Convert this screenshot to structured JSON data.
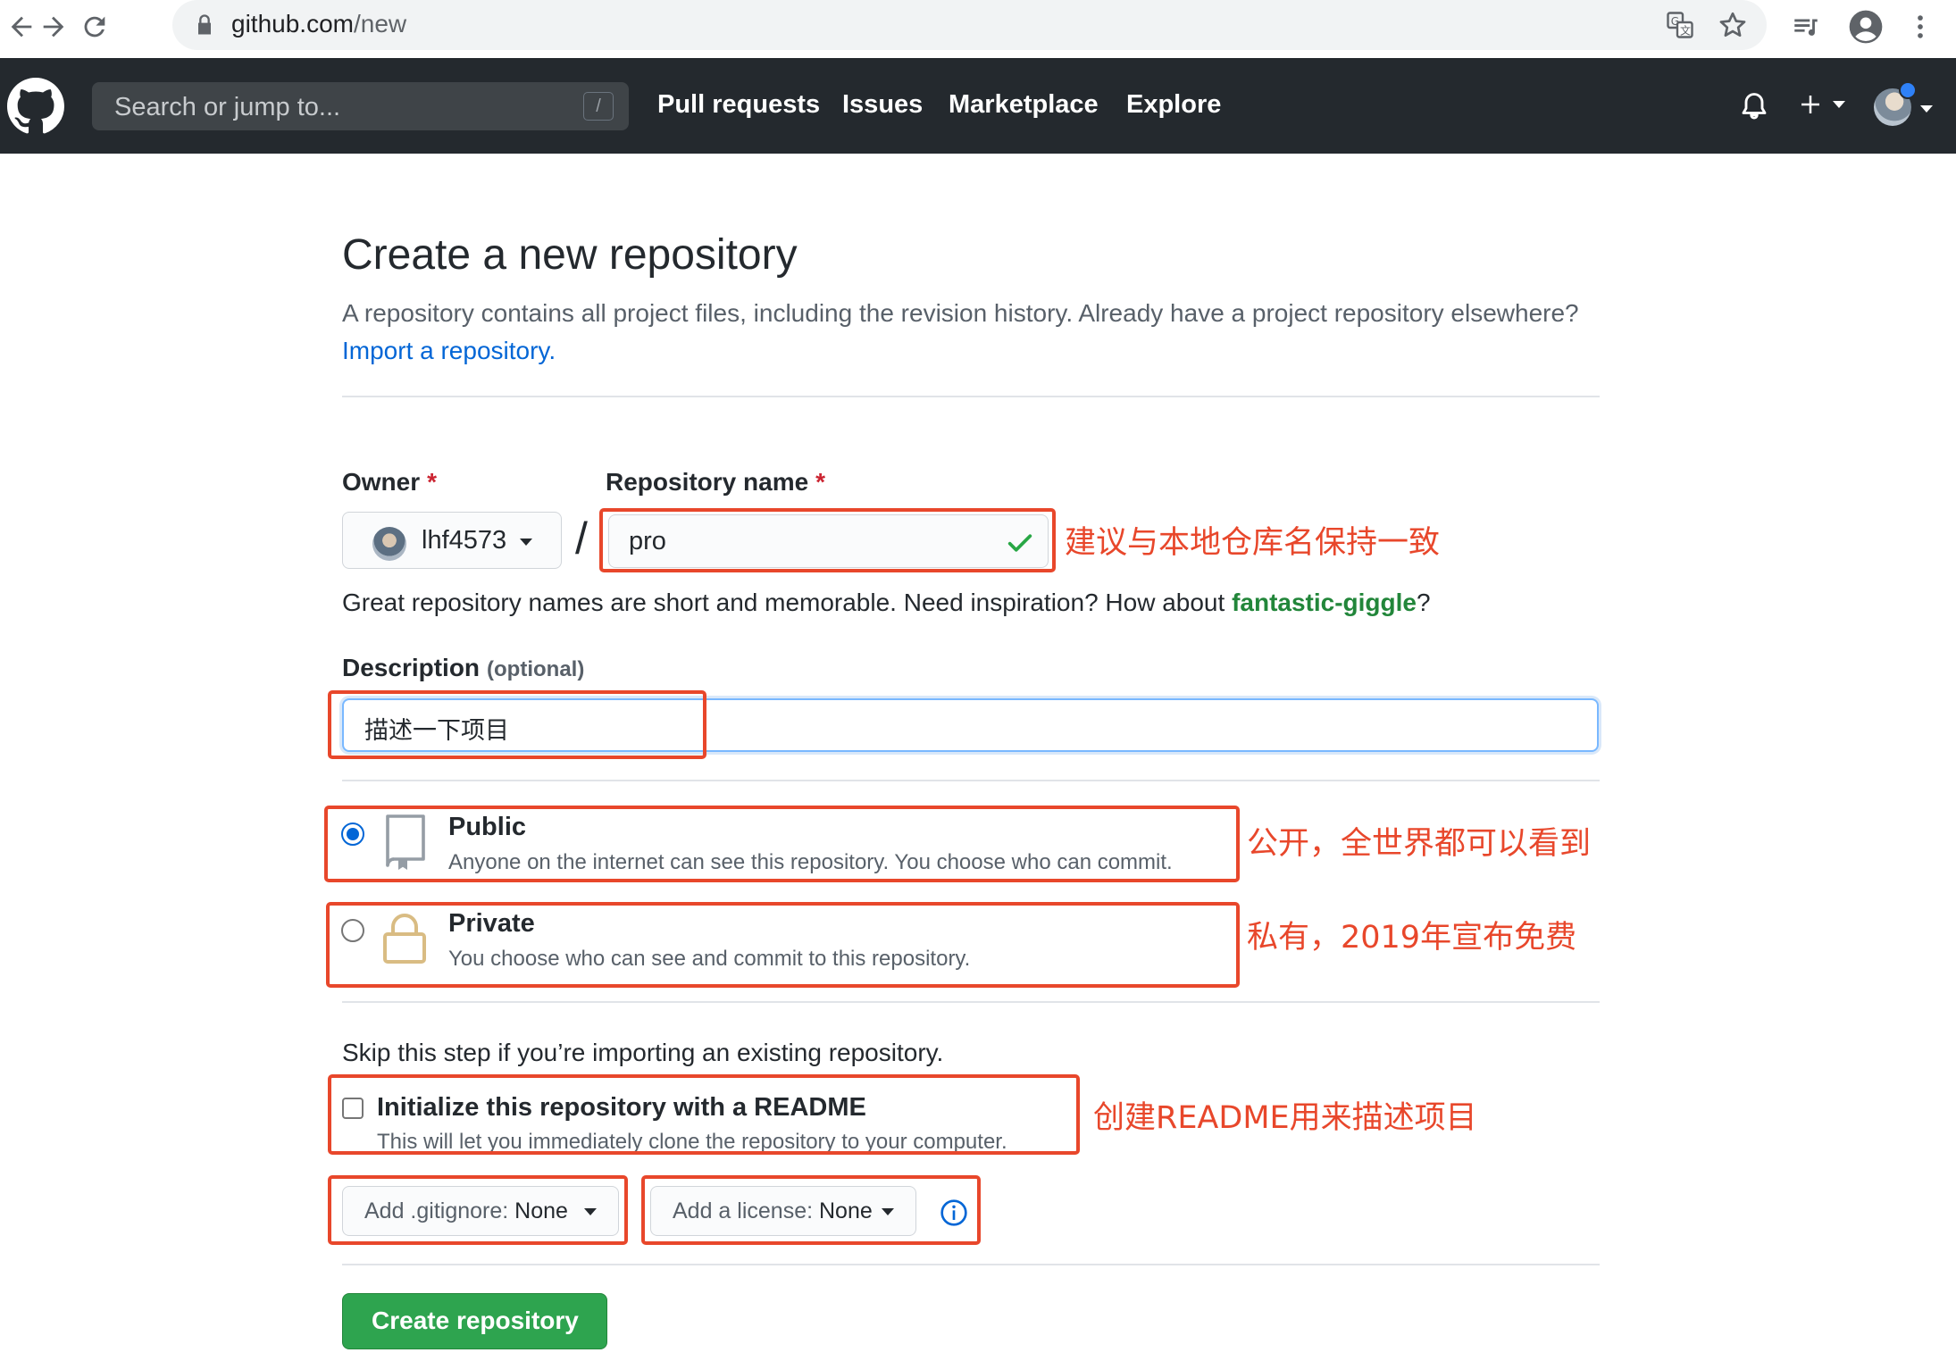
{
  "browser": {
    "url_host": "github.com",
    "url_path": "/new",
    "translate_icon": "translate-icon",
    "star_icon": "star-icon",
    "media_icon": "media-queue-icon",
    "profile_icon": "account-icon",
    "menu_icon": "kebab-menu-icon"
  },
  "header": {
    "search_placeholder": "Search or jump to...",
    "search_shortcut": "/",
    "nav": [
      "Pull requests",
      "Issues",
      "Marketplace",
      "Explore"
    ],
    "plus": "+"
  },
  "page": {
    "title": "Create a new repository",
    "subtitle": "A repository contains all project files, including the revision history. Already have a project repository elsewhere?",
    "import_link": "Import a repository.",
    "owner_label": "Owner",
    "owner_value": "lhf4573",
    "slash": "/",
    "repo_label": "Repository name",
    "required_mark": "*",
    "repo_value": "pro",
    "hint_prefix": "Great repository names are short and memorable. Need inspiration? How about ",
    "hint_suggestion": "fantastic-giggle",
    "hint_suffix": "?",
    "description_label": "Description",
    "description_optional": "(optional)",
    "description_value": "描述一下项目",
    "visibility": {
      "public_title": "Public",
      "public_desc": "Anyone on the internet can see this repository. You choose who can commit.",
      "private_title": "Private",
      "private_desc": "You choose who can see and commit to this repository.",
      "selected": "public"
    },
    "skip_text": "Skip this step if you’re importing an existing repository.",
    "readme_title": "Initialize this repository with a README",
    "readme_desc": "This will let you immediately clone the repository to your computer.",
    "readme_checked": false,
    "gitignore_label": "Add .gitignore:",
    "gitignore_value": "None",
    "license_label": "Add a license:",
    "license_value": "None",
    "create_button": "Create repository"
  },
  "annotations": {
    "repo_name_note": "建议与本地仓库名保持一致",
    "public_note": "公开，全世界都可以看到",
    "private_note": "私有，2019年宣布免费",
    "readme_note": "创建README用来描述项目",
    "color": "#e8472b"
  },
  "colors": {
    "header_bg": "#24292e",
    "link": "#0366d6",
    "create_green": "#2ea44f",
    "suggestion_green": "#22863a"
  }
}
